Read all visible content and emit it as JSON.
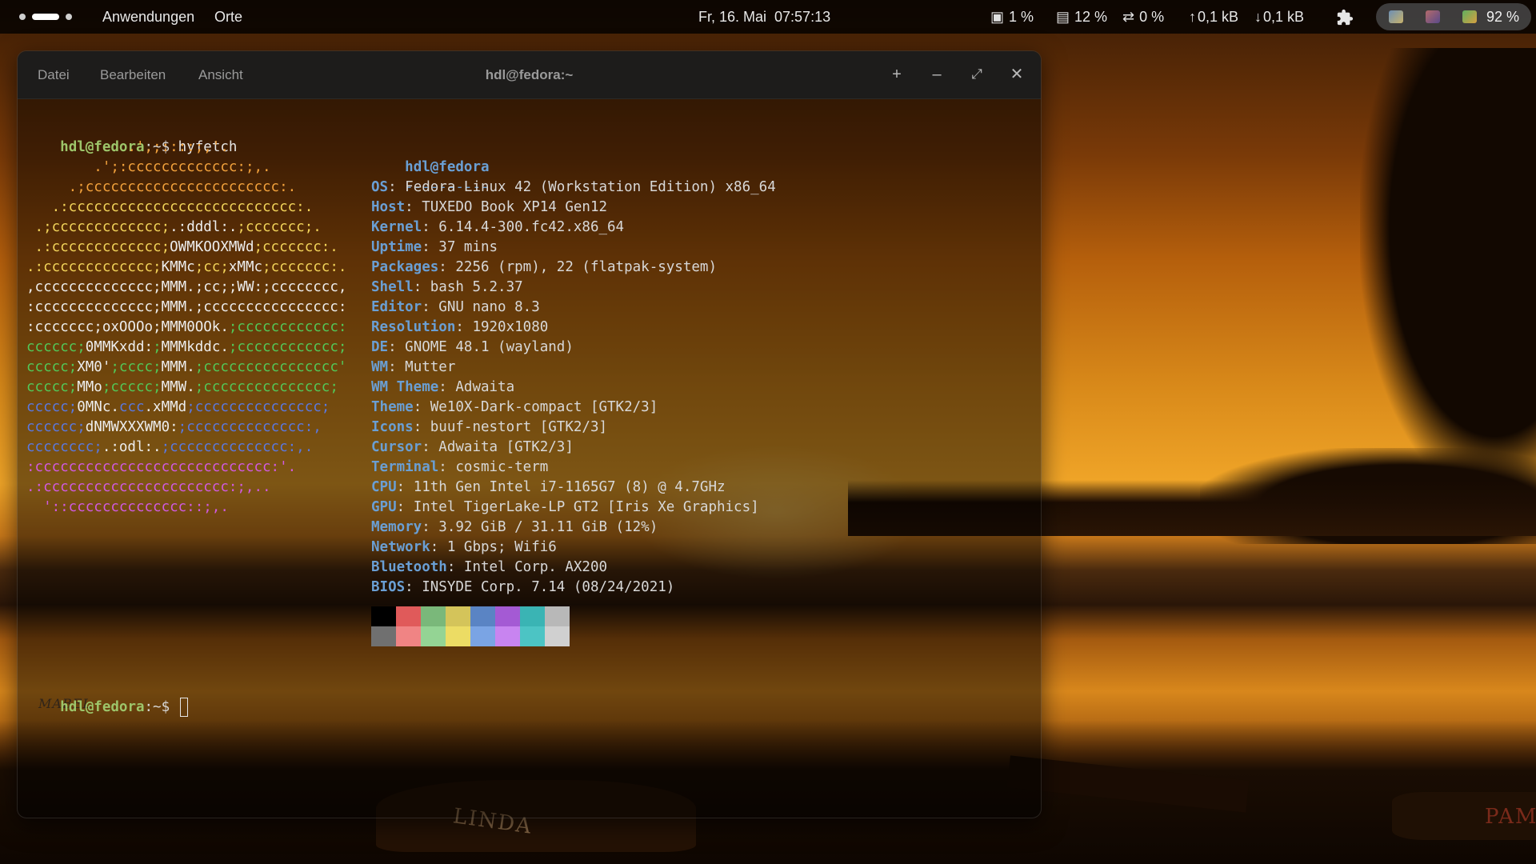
{
  "topbar": {
    "apps_label": "Anwendungen",
    "places_label": "Orte",
    "clock": "Fr, 16. Mai  07:57:13",
    "cpu": "1 %",
    "memory": "12 %",
    "swap": "0 %",
    "net_up": "0,1 kB",
    "net_down": "0,1 kB",
    "battery": "92 %"
  },
  "wallpaper": {
    "boat_names": [
      "LINDA",
      "PAM",
      "MABEL"
    ]
  },
  "terminal": {
    "menu": [
      "Datei",
      "Bearbeiten",
      "Ansicht"
    ],
    "title": "hdl@fedora:~",
    "prompt_user": "hdl@fedora",
    "prompt_sep": ":~$ ",
    "command": "hyfetch",
    "info_user": "hdl@fedora",
    "info_dash": "----------",
    "info": [
      {
        "key": "OS",
        "value": "Fedora Linux 42 (Workstation Edition) x86_64"
      },
      {
        "key": "Host",
        "value": "TUXEDO Book XP14 Gen12"
      },
      {
        "key": "Kernel",
        "value": "6.14.4-300.fc42.x86_64"
      },
      {
        "key": "Uptime",
        "value": "37 mins"
      },
      {
        "key": "Packages",
        "value": "2256 (rpm), 22 (flatpak-system)"
      },
      {
        "key": "Shell",
        "value": "bash 5.2.37"
      },
      {
        "key": "Editor",
        "value": "GNU nano 8.3"
      },
      {
        "key": "Resolution",
        "value": "1920x1080"
      },
      {
        "key": "DE",
        "value": "GNOME 48.1 (wayland)"
      },
      {
        "key": "WM",
        "value": "Mutter"
      },
      {
        "key": "WM Theme",
        "value": "Adwaita"
      },
      {
        "key": "Theme",
        "value": "We10X-Dark-compact [GTK2/3]"
      },
      {
        "key": "Icons",
        "value": "buuf-nestort [GTK2/3]"
      },
      {
        "key": "Cursor",
        "value": "Adwaita [GTK2/3]"
      },
      {
        "key": "Terminal",
        "value": "cosmic-term"
      },
      {
        "key": "CPU",
        "value": "11th Gen Intel i7-1165G7 (8) @ 4.7GHz"
      },
      {
        "key": "GPU",
        "value": "Intel TigerLake-LP GT2 [Iris Xe Graphics]"
      },
      {
        "key": "Memory",
        "value": "3.92 GiB / 31.11 GiB (12%)"
      },
      {
        "key": "Network",
        "value": "1 Gbps; Wifi6"
      },
      {
        "key": "Bluetooth",
        "value": "Intel Corp. AX200"
      },
      {
        "key": "BIOS",
        "value": "INSYDE Corp. 7.14 (08/24/2021)"
      }
    ],
    "ascii_logo": [
      {
        "segs": [
          [
            "            .',;::::;,'.",
            "orange"
          ]
        ]
      },
      {
        "segs": [
          [
            "        .';:cccccccccccc",
            "orange"
          ],
          [
            "c:;,.",
            "orange"
          ]
        ]
      },
      {
        "segs": [
          [
            "     .;cccccccccccccccccccc",
            "orange"
          ],
          [
            "ccc:.",
            "orange"
          ]
        ]
      },
      {
        "segs": [
          [
            "   .:cccccccccccccccccccccc",
            "yellow"
          ],
          [
            "ccccc:.",
            "yellow"
          ]
        ]
      },
      {
        "segs": [
          [
            " .;ccccccccccccc;",
            "yellow"
          ],
          [
            ".:dddl:.",
            "white"
          ],
          [
            ";ccccccc;.",
            "yellow"
          ]
        ]
      },
      {
        "segs": [
          [
            " .:ccccccccccccc;",
            "yellow"
          ],
          [
            "OWMKOOXMWd",
            "white"
          ],
          [
            ";ccccccc:.",
            "yellow"
          ]
        ]
      },
      {
        "segs": [
          [
            ".:ccccccccccccc;",
            "yellow"
          ],
          [
            "KMMc",
            "white"
          ],
          [
            ";cc;",
            "yellow"
          ],
          [
            "xMMc",
            "white"
          ],
          [
            ";ccccccc:.",
            "yellow"
          ]
        ]
      },
      {
        "segs": [
          [
            ",cccccccccccccc;",
            "white"
          ],
          [
            "MMM.",
            "white"
          ],
          [
            ";cc;",
            "white"
          ],
          [
            ";WW:",
            "white"
          ],
          [
            ";cccccccc,",
            "white"
          ]
        ]
      },
      {
        "segs": [
          [
            ":cccccccccccccc;",
            "white"
          ],
          [
            "MMM.",
            "white"
          ],
          [
            ";cccccccccccccccc:",
            "white"
          ]
        ]
      },
      {
        "segs": [
          [
            ":ccccccc;",
            "white"
          ],
          [
            "oxOOOo",
            "white"
          ],
          [
            ";",
            "white"
          ],
          [
            "MMM0OOk.",
            "white"
          ],
          [
            ";cccccccccccc:",
            "green"
          ]
        ]
      },
      {
        "segs": [
          [
            "cccccc;",
            "green"
          ],
          [
            "0MMKxdd:",
            "white"
          ],
          [
            ";",
            "green"
          ],
          [
            "MMMkddc.",
            "white"
          ],
          [
            ";cccccccccccc;",
            "green"
          ]
        ]
      },
      {
        "segs": [
          [
            "ccccc;",
            "green"
          ],
          [
            "XM0'",
            "white"
          ],
          [
            ";cccc;",
            "green"
          ],
          [
            "MMM.",
            "white"
          ],
          [
            ";cccccccccccccccc'",
            "green"
          ]
        ]
      },
      {
        "segs": [
          [
            "ccccc;",
            "green"
          ],
          [
            "MMo",
            "white"
          ],
          [
            ";ccccc;",
            "green"
          ],
          [
            "MMW.",
            "white"
          ],
          [
            ";ccccccccccccccc;",
            "green"
          ]
        ]
      },
      {
        "segs": [
          [
            "ccccc;",
            "blue"
          ],
          [
            "0MNc.",
            "white"
          ],
          [
            "ccc",
            "blue"
          ],
          [
            ".xMMd",
            "white"
          ],
          [
            ";ccccccccccccccc;",
            "blue"
          ]
        ]
      },
      {
        "segs": [
          [
            "cccccc;",
            "blue"
          ],
          [
            "dNMWXXXWM0:",
            "white"
          ],
          [
            ";cccccccccccccc:,",
            "blue"
          ]
        ]
      },
      {
        "segs": [
          [
            "cccccccc;",
            "blue"
          ],
          [
            ".:odl:.",
            "white"
          ],
          [
            ";cccccccccccccc:,.",
            "blue"
          ]
        ]
      },
      {
        "segs": [
          [
            ":cccccccccccccccccccccccccccc:'.",
            "pink"
          ]
        ]
      },
      {
        "segs": [
          [
            ".:cccccccccccccccccccccc:;,..",
            "pink"
          ]
        ]
      },
      {
        "segs": [
          [
            "  '::cccccccccccccc::;,.",
            "pink"
          ]
        ]
      }
    ],
    "palette_top": [
      "#000000",
      "#e05a5a",
      "#7ab87a",
      "#d4c45a",
      "#5a84c4",
      "#a45ad4",
      "#3ab4b4",
      "#b8b8b8"
    ],
    "palette_bottom": [
      "#707070",
      "#f08484",
      "#94d494",
      "#ecdc64",
      "#7aa4e4",
      "#c884f0",
      "#4cc4c4",
      "#d0d0d0"
    ]
  }
}
